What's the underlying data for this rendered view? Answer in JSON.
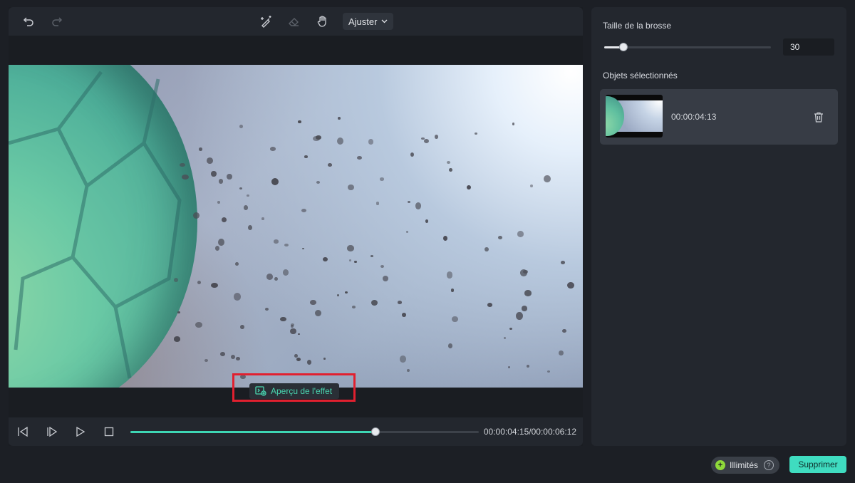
{
  "toolbar": {
    "fit_label": "Ajuster"
  },
  "preview": {
    "effect_label": "Aperçu de l'effet"
  },
  "playback": {
    "progress_fraction": 0.704,
    "timecode": "00:00:04:15/00:00:06:12"
  },
  "brush": {
    "label": "Taille de la brosse",
    "value": "30",
    "slider_fraction": 0.115
  },
  "objects": {
    "label": "Objets sélectionnés",
    "items": [
      {
        "time": "00:00:04:13"
      }
    ]
  },
  "footer": {
    "badge_label": "Illimités",
    "delete_label": "Supprimer"
  },
  "colors": {
    "accent": "#3fdcc0",
    "highlight_box": "#e1202f"
  }
}
